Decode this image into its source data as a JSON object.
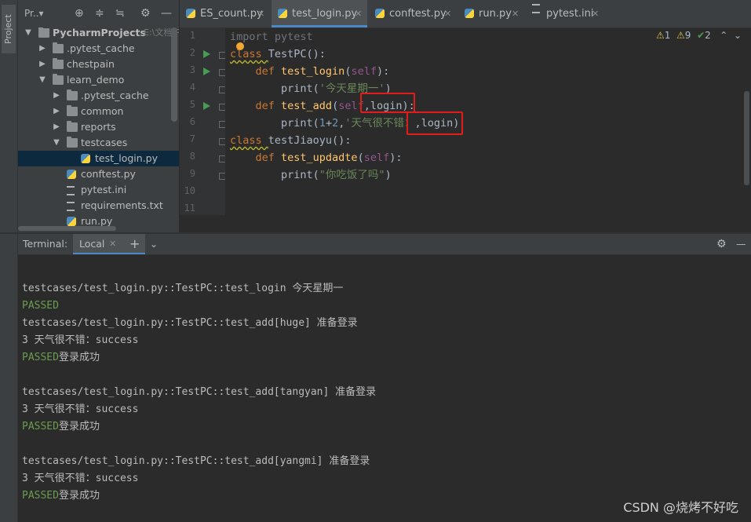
{
  "left_strip": {
    "tab": "Project"
  },
  "project_toolbar": {
    "title": "Pr..▾",
    "icons": [
      "target-icon",
      "expand-icon",
      "collapse-icon",
      "gear-icon",
      "minimize-icon"
    ]
  },
  "project_tree": [
    {
      "label": "PycharmProjects",
      "hint": "E:\\文档\\P",
      "type": "folder",
      "bold": true
    },
    {
      "label": ".pytest_cache",
      "type": "folder"
    },
    {
      "label": "chestpain",
      "type": "folder"
    },
    {
      "label": "learn_demo",
      "type": "folder"
    },
    {
      "label": ".pytest_cache",
      "type": "folder"
    },
    {
      "label": "common",
      "type": "folder"
    },
    {
      "label": "reports",
      "type": "folder"
    },
    {
      "label": "testcases",
      "type": "folder"
    },
    {
      "label": "test_login.py",
      "type": "py",
      "selected": true
    },
    {
      "label": "conftest.py",
      "type": "py"
    },
    {
      "label": "pytest.ini",
      "type": "ini"
    },
    {
      "label": "requirements.txt",
      "type": "txt"
    },
    {
      "label": "run.py",
      "type": "py"
    }
  ],
  "tabs": [
    {
      "label": "ES_count.py",
      "icon": "python-file-icon"
    },
    {
      "label": "test_login.py",
      "icon": "python-file-icon",
      "active": true
    },
    {
      "label": "conftest.py",
      "icon": "python-file-icon"
    },
    {
      "label": "run.py",
      "icon": "python-file-icon"
    },
    {
      "label": "pytest.ini",
      "icon": "ini-file-icon"
    }
  ],
  "inspections": {
    "warnings": "1",
    "weak_warnings": "9",
    "typos": "2"
  },
  "editor": {
    "line_numbers": [
      "1",
      "2",
      "3",
      "4",
      "5",
      "6",
      "7",
      "8",
      "9",
      "10",
      "11"
    ],
    "lines": [
      {
        "parts": [
          [
            "dim",
            "import "
          ],
          [
            "dim",
            "pytest"
          ]
        ]
      },
      {
        "parts": [
          [
            "kw",
            "class "
          ],
          [
            "id",
            "TestPC():"
          ]
        ]
      },
      {
        "parts": [
          [
            "id",
            "    "
          ],
          [
            "kw",
            "def "
          ],
          [
            "fn",
            "test_login"
          ],
          [
            "id",
            "("
          ],
          [
            "self",
            "self"
          ],
          [
            "id",
            "):"
          ]
        ]
      },
      {
        "parts": [
          [
            "id",
            "        print("
          ],
          [
            "str",
            "'今天星期一'"
          ],
          [
            "id",
            ")"
          ]
        ]
      },
      {
        "parts": [
          [
            "id",
            "    "
          ],
          [
            "kw",
            "def "
          ],
          [
            "fn",
            "test_add"
          ],
          [
            "id",
            "("
          ],
          [
            "self",
            "self"
          ],
          [
            "id",
            ",login):"
          ]
        ]
      },
      {
        "parts": [
          [
            "id",
            "        print("
          ],
          [
            "num",
            "1"
          ],
          [
            "id",
            "+"
          ],
          [
            "num",
            "2"
          ],
          [
            "id",
            ","
          ],
          [
            "str",
            "'天气很不错："
          ],
          [
            "id",
            ",login)"
          ]
        ]
      },
      {
        "parts": [
          [
            "kw",
            "class "
          ],
          [
            "id",
            "testJiaoyu():"
          ]
        ]
      },
      {
        "parts": [
          [
            "id",
            "    "
          ],
          [
            "kw",
            "def "
          ],
          [
            "fn",
            "test_updadte"
          ],
          [
            "id",
            "("
          ],
          [
            "self",
            "self"
          ],
          [
            "id",
            "):"
          ]
        ]
      },
      {
        "parts": [
          [
            "id",
            "        print("
          ],
          [
            "str",
            "\"你吃饭了吗\""
          ],
          [
            "id",
            ")"
          ]
        ]
      },
      {
        "parts": []
      },
      {
        "parts": []
      }
    ]
  },
  "terminal": {
    "label": "Terminal:",
    "tab": "Local",
    "lines": [
      {
        "text": ""
      },
      {
        "text": "testcases/test_login.py::TestPC::test_login 今天星期一"
      },
      {
        "passed": "PASSED",
        "text": ""
      },
      {
        "text": "testcases/test_login.py::TestPC::test_add[huge] 准备登录"
      },
      {
        "text": "3 天气很不错：success"
      },
      {
        "passed": "PASSED",
        "text": "登录成功"
      },
      {
        "text": ""
      },
      {
        "text": "testcases/test_login.py::TestPC::test_add[tangyan] 准备登录"
      },
      {
        "text": "3 天气很不错：success"
      },
      {
        "passed": "PASSED",
        "text": "登录成功"
      },
      {
        "text": ""
      },
      {
        "text": "testcases/test_login.py::TestPC::test_add[yangmi] 准备登录"
      },
      {
        "text": "3 天气很不错：success"
      },
      {
        "passed": "PASSED",
        "text": "登录成功"
      }
    ]
  },
  "watermark": "CSDN @烧烤不好吃"
}
